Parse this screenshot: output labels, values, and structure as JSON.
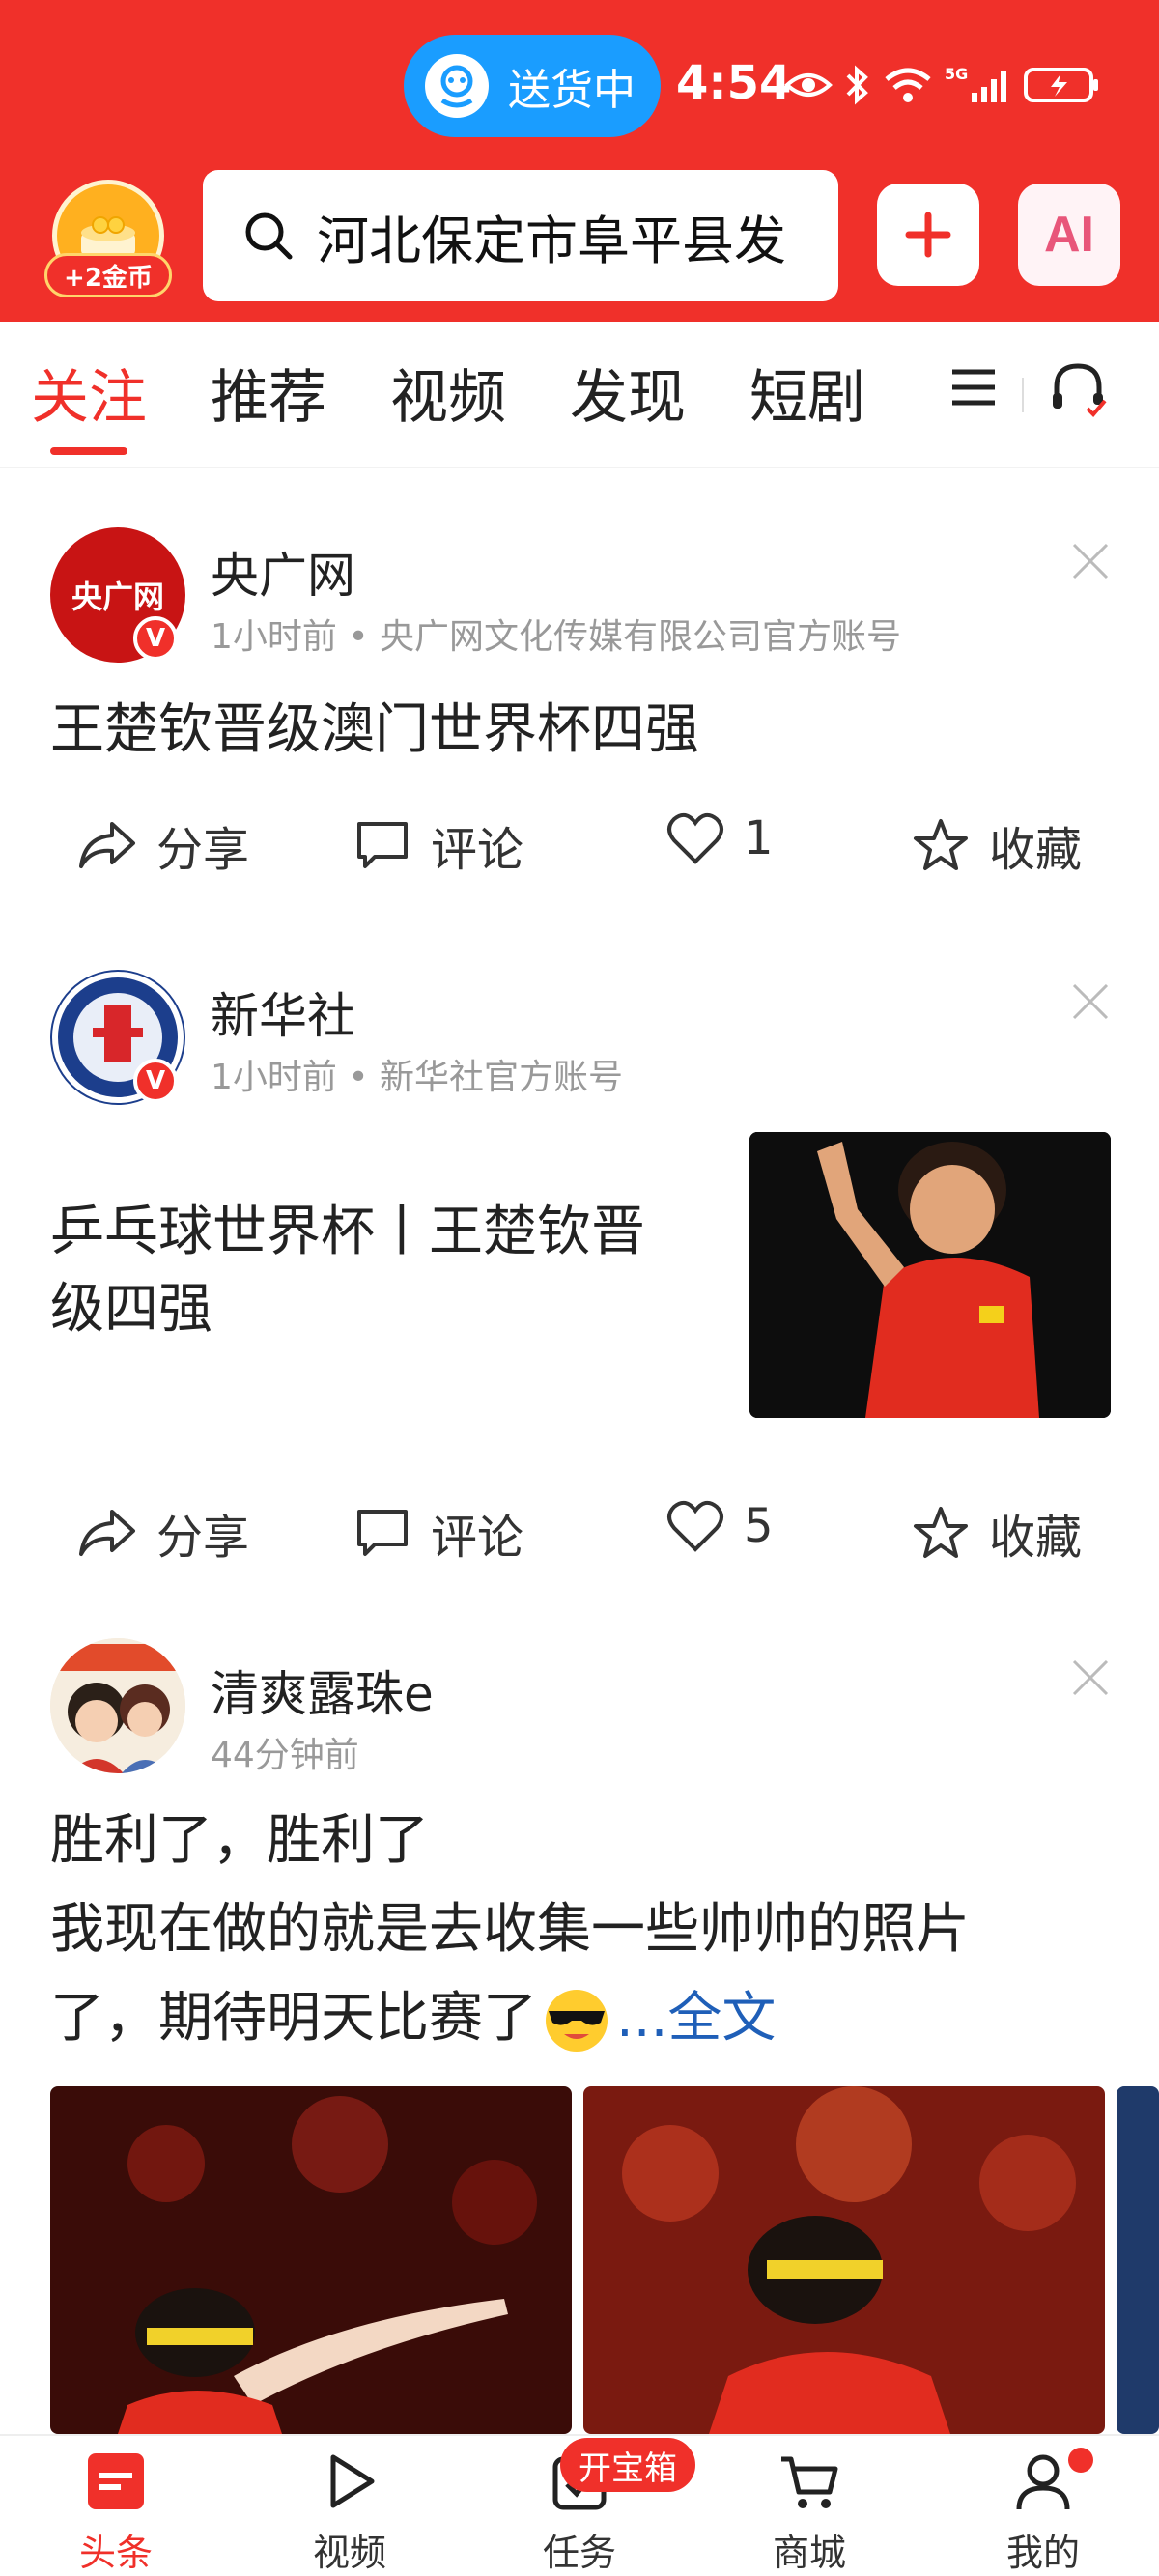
{
  "status_bar": {
    "delivery_label": "送货中",
    "time": "4:54"
  },
  "header": {
    "coin_badge": "+2金币",
    "search_query": "河北保定市阜平县发",
    "ai_label": "AI"
  },
  "tabs": [
    "关注",
    "推荐",
    "视频",
    "发现",
    "短剧"
  ],
  "posts": [
    {
      "author": "央广网",
      "avatar_text": "央广网",
      "meta": "1小时前 • 央广网文化传媒有限公司官方账号",
      "headline": "王楚钦晋级澳门世界杯四强",
      "actions": {
        "share": "分享",
        "comment": "评论",
        "likes": "1",
        "favorite": "收藏"
      }
    },
    {
      "author": "新华社",
      "meta": "1小时前 • 新华社官方账号",
      "headline_line1": "乒乓球世界杯丨王楚钦晋",
      "headline_line2": "级四强",
      "actions": {
        "share": "分享",
        "comment": "评论",
        "likes": "5",
        "favorite": "收藏"
      }
    },
    {
      "author": "清爽露珠e",
      "meta": "44分钟前",
      "line1": "胜利了，胜利了",
      "line2": "我现在做的就是去收集一些帅帅的照片",
      "line3": "了，期待明天比赛了",
      "more_link": "...全文"
    }
  ],
  "bottom_nav": {
    "items": [
      "头条",
      "视频",
      "任务",
      "商城",
      "我的"
    ],
    "treasure_badge": "开宝箱"
  },
  "colors": {
    "brand_red": "#f0302a",
    "delivery_blue": "#1a9dff",
    "link_blue": "#1f5fb8"
  }
}
